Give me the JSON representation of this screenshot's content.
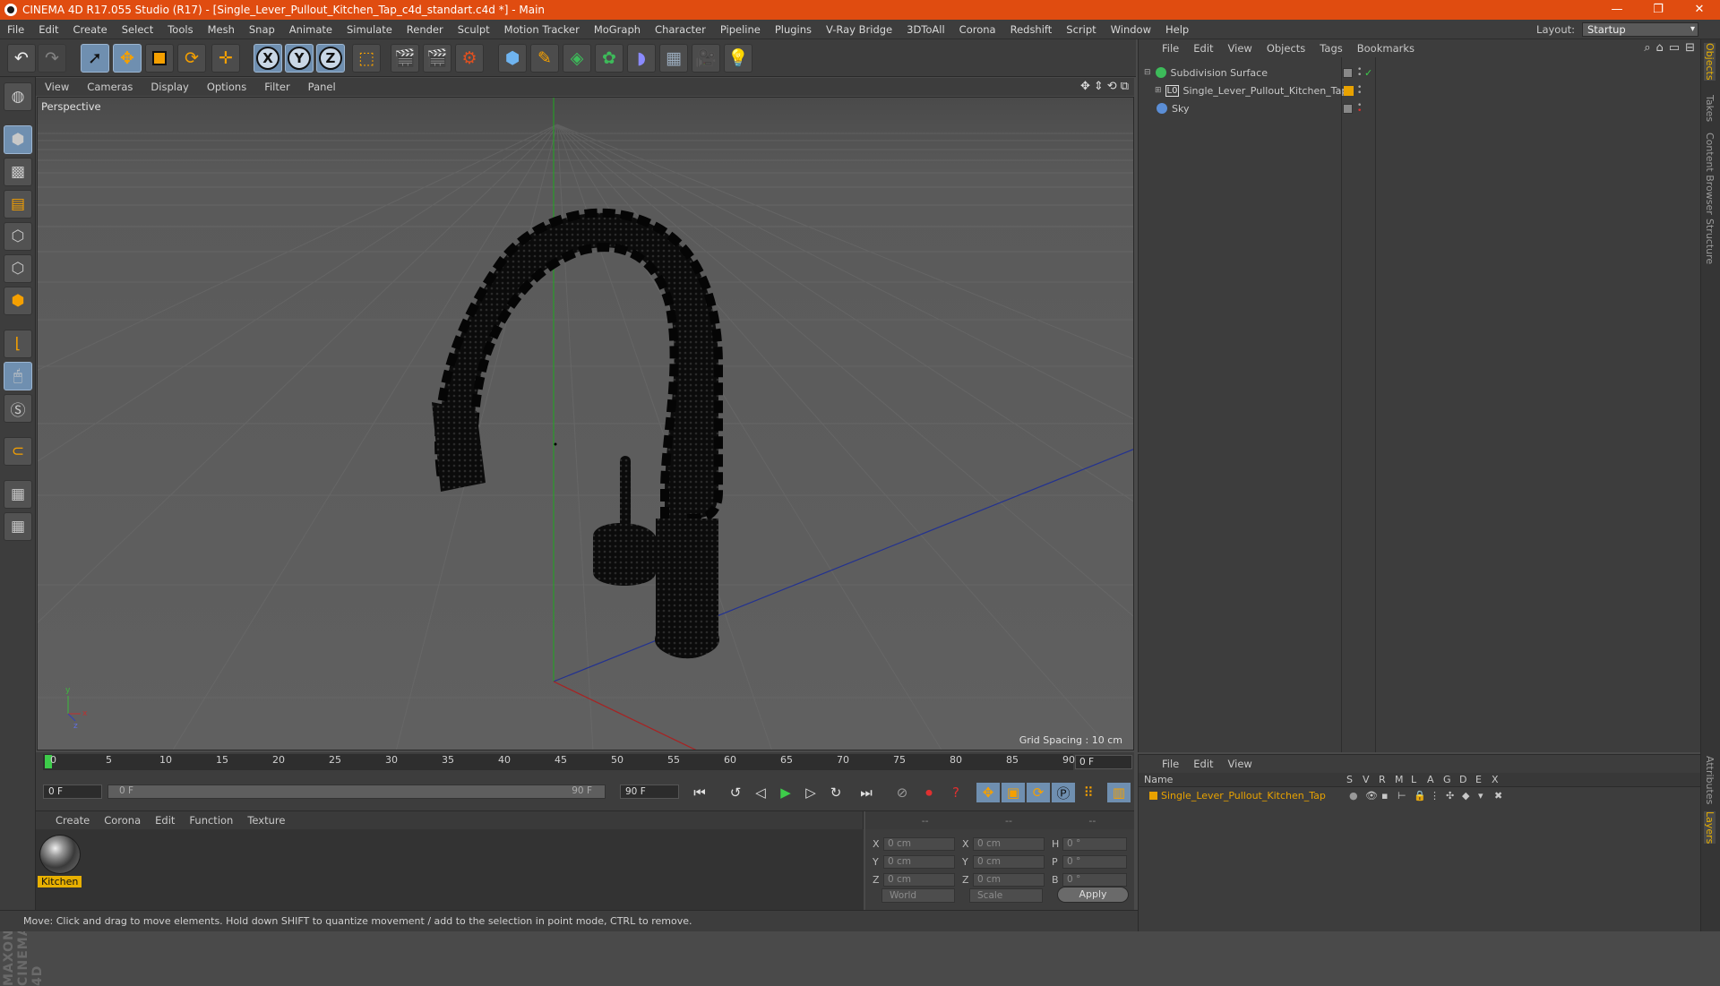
{
  "window": {
    "title": "CINEMA 4D R17.055 Studio (R17) - [Single_Lever_Pullout_Kitchen_Tap_c4d_standart.c4d *] - Main",
    "minimize": "—",
    "restore": "❐",
    "close": "✕"
  },
  "menubar": {
    "items": [
      "File",
      "Edit",
      "Create",
      "Select",
      "Tools",
      "Mesh",
      "Snap",
      "Animate",
      "Simulate",
      "Render",
      "Sculpt",
      "Motion Tracker",
      "MoGraph",
      "Character",
      "Pipeline",
      "Plugins",
      "V-Ray Bridge",
      "3DToAll",
      "Corona",
      "Redshift",
      "Script",
      "Window",
      "Help"
    ],
    "layout_label": "Layout:",
    "layout_value": "Startup"
  },
  "viewport": {
    "menu": [
      "View",
      "Cameras",
      "Display",
      "Options",
      "Filter",
      "Panel"
    ],
    "label": "Perspective",
    "grid_spacing": "Grid Spacing : 10 cm"
  },
  "timeline": {
    "ticks": [
      "0",
      "5",
      "10",
      "15",
      "20",
      "25",
      "30",
      "35",
      "40",
      "45",
      "50",
      "55",
      "60",
      "65",
      "70",
      "75",
      "80",
      "85",
      "90"
    ],
    "current_frame": "0 F"
  },
  "transport": {
    "start_field": "0 F",
    "range_start": "0 F",
    "range_end": "90 F",
    "end_field": "90 F"
  },
  "material_manager": {
    "menu": [
      "Create",
      "Corona",
      "Edit",
      "Function",
      "Texture"
    ],
    "material_name": "Kitchen"
  },
  "coordinates": {
    "headers": [
      "--",
      "--",
      "--"
    ],
    "rows": [
      {
        "l1": "X",
        "v1": "0 cm",
        "l2": "X",
        "v2": "0 cm",
        "l3": "H",
        "v3": "0 °"
      },
      {
        "l1": "Y",
        "v1": "0 cm",
        "l2": "Y",
        "v2": "0 cm",
        "l3": "P",
        "v3": "0 °"
      },
      {
        "l1": "Z",
        "v1": "0 cm",
        "l2": "Z",
        "v2": "0 cm",
        "l3": "B",
        "v3": "0 °"
      }
    ],
    "space": "World",
    "mode": "Scale",
    "apply": "Apply"
  },
  "object_manager": {
    "menu": [
      "File",
      "Edit",
      "View",
      "Objects",
      "Tags",
      "Bookmarks"
    ],
    "objects": [
      {
        "name": "Subdivision Surface",
        "color": "#3dbb5a"
      },
      {
        "name": "Single_Lever_Pullout_Kitchen_Tap",
        "color": "#e8a200"
      },
      {
        "name": "Sky",
        "color": "#5b8ed6"
      }
    ]
  },
  "layer_manager": {
    "menu": [
      "File",
      "Edit",
      "View"
    ],
    "columns": [
      "Name",
      "S",
      "V",
      "R",
      "M",
      "L",
      "A",
      "G",
      "D",
      "E",
      "X"
    ],
    "layer_name": "Single_Lever_Pullout_Kitchen_Tap"
  },
  "right_tabs": [
    "Objects",
    "Takes",
    "Content Browser",
    "Structure",
    "Attributes",
    "Layers"
  ],
  "status": "Move: Click and drag to move elements. Hold down SHIFT to quantize movement / add to the selection in point mode, CTRL to remove.",
  "branding": "MAXON CINEMA 4D"
}
